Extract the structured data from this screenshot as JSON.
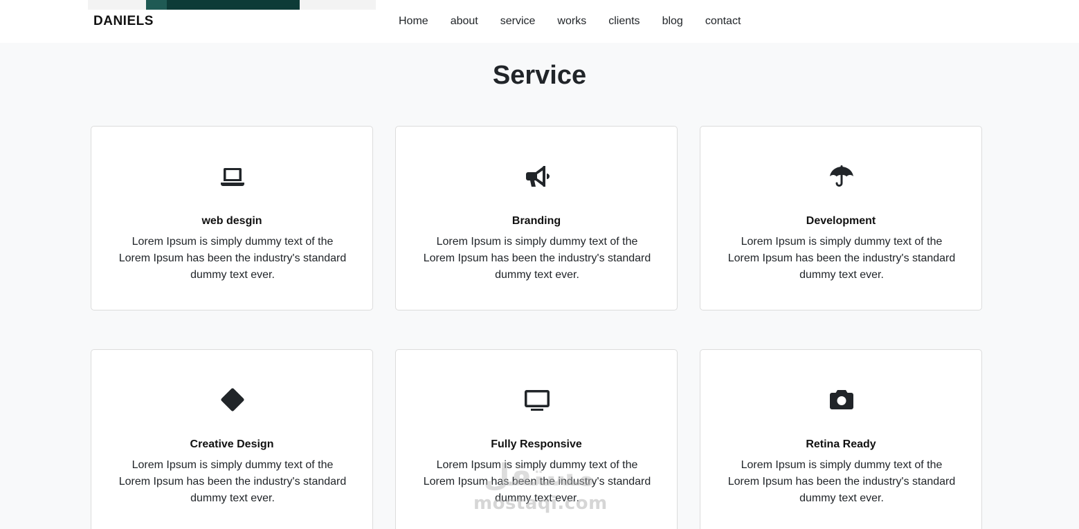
{
  "navbar": {
    "brand": "DANIELS",
    "links": [
      "Home",
      "about",
      "service",
      "works",
      "clients",
      "blog",
      "contact"
    ]
  },
  "section": {
    "title": "Service"
  },
  "cards": [
    {
      "icon": "laptop-icon",
      "title": "web desgin",
      "text": "Lorem Ipsum is simply dummy text of the Lorem Ipsum has been the industry's standard dummy text ever."
    },
    {
      "icon": "megaphone-icon",
      "title": "Branding",
      "text": "Lorem Ipsum is simply dummy text of the Lorem Ipsum has been the industry's standard dummy text ever."
    },
    {
      "icon": "umbrella-icon",
      "title": "Development",
      "text": "Lorem Ipsum is simply dummy text of the Lorem Ipsum has been the industry's standard dummy text ever."
    },
    {
      "icon": "diamond-icon",
      "title": "Creative Design",
      "text": "Lorem Ipsum is simply dummy text of the Lorem Ipsum has been the industry's standard dummy text ever."
    },
    {
      "icon": "tv-icon",
      "title": "Fully Responsive",
      "text": "Lorem Ipsum is simply dummy text of the Lorem Ipsum has been the industry's standard dummy text ever."
    },
    {
      "icon": "camera-icon",
      "title": "Retina Ready",
      "text": "Lorem Ipsum is simply dummy text of the Lorem Ipsum has been the industry's standard dummy text ever."
    }
  ],
  "watermark": {
    "arabic": "مستقل",
    "latin": "mostaqi.com"
  }
}
